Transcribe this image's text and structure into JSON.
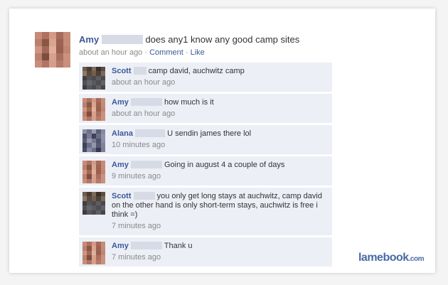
{
  "post": {
    "author": "Amy",
    "text": "does any1 know any good camp sites",
    "time": "about an hour ago",
    "separator": "·",
    "comment_label": "Comment",
    "like_label": "Like",
    "avatar_colors": [
      "#c98a78",
      "#b07060",
      "#d49a85",
      "#a76a5a",
      "#c58c79",
      "#b8806d",
      "#8a5646",
      "#d8a590",
      "#9c6252",
      "#c48b77",
      "#cf9582",
      "#a36857",
      "#e0b09c",
      "#9a5f4e",
      "#c08470",
      "#bd826f",
      "#7f4d3f",
      "#d7a18c",
      "#a9705f",
      "#cc917e",
      "#c78d79",
      "#b27563",
      "#d4a08c",
      "#b67a68",
      "#c9907c"
    ]
  },
  "comments": [
    {
      "author": "Scott",
      "text": "camp david, auchwitz camp",
      "time": "about an hour ago",
      "avatar_colors": [
        "#6e5c4e",
        "#4a3b32",
        "#7d6b5c",
        "#3a3029",
        "#5d4d41",
        "#8a7868",
        "#5a4a3e",
        "#6f5f50",
        "#4e4036",
        "#7a6a5b",
        "#3f3f42",
        "#55555a",
        "#4a4a4f",
        "#5c5c61",
        "#48484c",
        "#505055",
        "#66666b",
        "#59595e",
        "#4d4d52",
        "#626267",
        "#3d3d41",
        "#58585d",
        "#4b4b50",
        "#606065",
        "#45454a"
      ]
    },
    {
      "author": "Amy",
      "text": "how much is it",
      "time": "about an hour ago",
      "avatar_colors": [
        "#c98a78",
        "#b07060",
        "#d49a85",
        "#a76a5a",
        "#c58c79",
        "#b8806d",
        "#8a5646",
        "#d8a590",
        "#9c6252",
        "#c48b77",
        "#cf9582",
        "#a36857",
        "#e0b09c",
        "#9a5f4e",
        "#c08470",
        "#bd826f",
        "#7f4d3f",
        "#d7a18c",
        "#a9705f",
        "#cc917e",
        "#c78d79",
        "#b27563",
        "#d4a08c",
        "#b67a68",
        "#c9907c"
      ]
    },
    {
      "author": "Alana",
      "text": "U sendin james there lol",
      "time": "10 minutes ago",
      "avatar_colors": [
        "#8c8fa6",
        "#6d7088",
        "#9a9db3",
        "#5c5f78",
        "#8588a0",
        "#4f5168",
        "#7a7d95",
        "#3e4057",
        "#6a6d85",
        "#8e91a8",
        "#5a5d75",
        "#9598ae",
        "#7478903",
        "#505369",
        "#8b8ea5",
        "#3f4259",
        "#6c6f87",
        "#9396ac",
        "#575a72",
        "#7f8299",
        "#4a4d64",
        "#888ba2",
        "#6b6e86",
        "#363950",
        "#7c7f97"
      ]
    },
    {
      "author": "Amy",
      "text": "Going in august 4 a couple of days",
      "time": "9 minutes ago",
      "avatar_colors": [
        "#c98a78",
        "#b07060",
        "#d49a85",
        "#a76a5a",
        "#c58c79",
        "#b8806d",
        "#8a5646",
        "#d8a590",
        "#9c6252",
        "#c48b77",
        "#cf9582",
        "#a36857",
        "#e0b09c",
        "#9a5f4e",
        "#c08470",
        "#bd826f",
        "#7f4d3f",
        "#d7a18c",
        "#a9705f",
        "#cc917e",
        "#c78d79",
        "#b27563",
        "#d4a08c",
        "#b67a68",
        "#c9907c"
      ]
    },
    {
      "author": "Scott",
      "text": "you only get long stays at auchwitz, camp david on the other hand is only short-term stays, auchwitz is free i think =)",
      "time": "7 minutes ago",
      "avatar_colors": [
        "#6e5c4e",
        "#4a3b32",
        "#7d6b5c",
        "#3a3029",
        "#5d4d41",
        "#8a7868",
        "#5a4a3e",
        "#6f5f50",
        "#4e4036",
        "#7a6a5b",
        "#3f3f42",
        "#55555a",
        "#4a4a4f",
        "#5c5c61",
        "#48484c",
        "#505055",
        "#66666b",
        "#59595e",
        "#4d4d52",
        "#626267",
        "#3d3d41",
        "#58585d",
        "#4b4b50",
        "#606065",
        "#45454a"
      ]
    },
    {
      "author": "Amy",
      "text": "Thank u",
      "time": "7 minutes ago",
      "avatar_colors": [
        "#c98a78",
        "#b07060",
        "#d49a85",
        "#a76a5a",
        "#c58c79",
        "#b8806d",
        "#8a5646",
        "#d8a590",
        "#9c6252",
        "#c48b77",
        "#cf9582",
        "#a36857",
        "#e0b09c",
        "#9a5f4e",
        "#c08470",
        "#bd826f",
        "#7f4d3f",
        "#d7a18c",
        "#a9705f",
        "#cc917e",
        "#c78d79",
        "#b27563",
        "#d4a08c",
        "#b67a68",
        "#c9907c"
      ]
    }
  ],
  "watermark": {
    "brand": "lamebook",
    "suffix": ".com"
  },
  "colors": {
    "link_blue": "#3b5998",
    "comment_bg": "#eceff5",
    "meta_gray": "#8a8a8a",
    "censor_bar": "#d7dbe6"
  }
}
